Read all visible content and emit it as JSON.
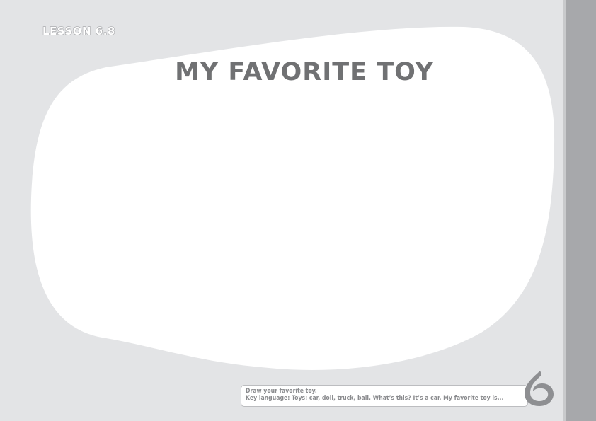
{
  "lesson": {
    "label": "LESSON 6.8"
  },
  "page": {
    "title": "MY FAVORITE TOY"
  },
  "instructions": {
    "line1": "Draw your favorite toy.",
    "line2": "Key language: Toys: car, doll, truck, ball. What’s this? It’s a car. My favorite toy is..."
  },
  "logo": {
    "icon": "swirl-6-logo-icon"
  },
  "colors": {
    "background": "#e3e4e6",
    "sidebar": "#a7a8ab",
    "drawing_area": "#ffffff",
    "title_text": "#707173"
  }
}
